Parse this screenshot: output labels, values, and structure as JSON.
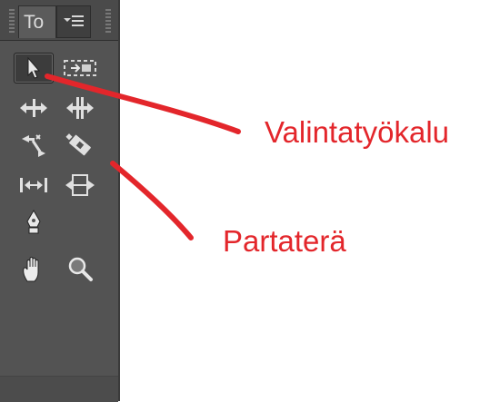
{
  "tools_panel": {
    "tab_title": "To",
    "menu_icon": "panel-menu-icon",
    "tools": [
      {
        "name": "selection-tool",
        "icon": "arrow-cursor-icon",
        "selected": true
      },
      {
        "name": "track-select-tool",
        "icon": "track-select-icon",
        "selected": false
      },
      {
        "name": "ripple-edit-tool",
        "icon": "ripple-edit-icon",
        "selected": false
      },
      {
        "name": "rolling-edit-tool",
        "icon": "rolling-edit-icon",
        "selected": false
      },
      {
        "name": "rate-stretch-tool",
        "icon": "rate-stretch-icon",
        "selected": false
      },
      {
        "name": "razor-tool",
        "icon": "razor-icon",
        "selected": false
      },
      {
        "name": "slip-tool",
        "icon": "slip-icon",
        "selected": false
      },
      {
        "name": "slide-tool",
        "icon": "slide-icon",
        "selected": false
      },
      {
        "name": "pen-tool",
        "icon": "pen-icon",
        "selected": false
      },
      {
        "name": "hand-tool",
        "icon": "hand-icon",
        "selected": false
      },
      {
        "name": "zoom-tool",
        "icon": "magnifier-icon",
        "selected": false
      }
    ]
  },
  "annotations": {
    "selection_label": "Valintatyökalu",
    "razor_label": "Partaterä",
    "color": "#e3262b"
  }
}
